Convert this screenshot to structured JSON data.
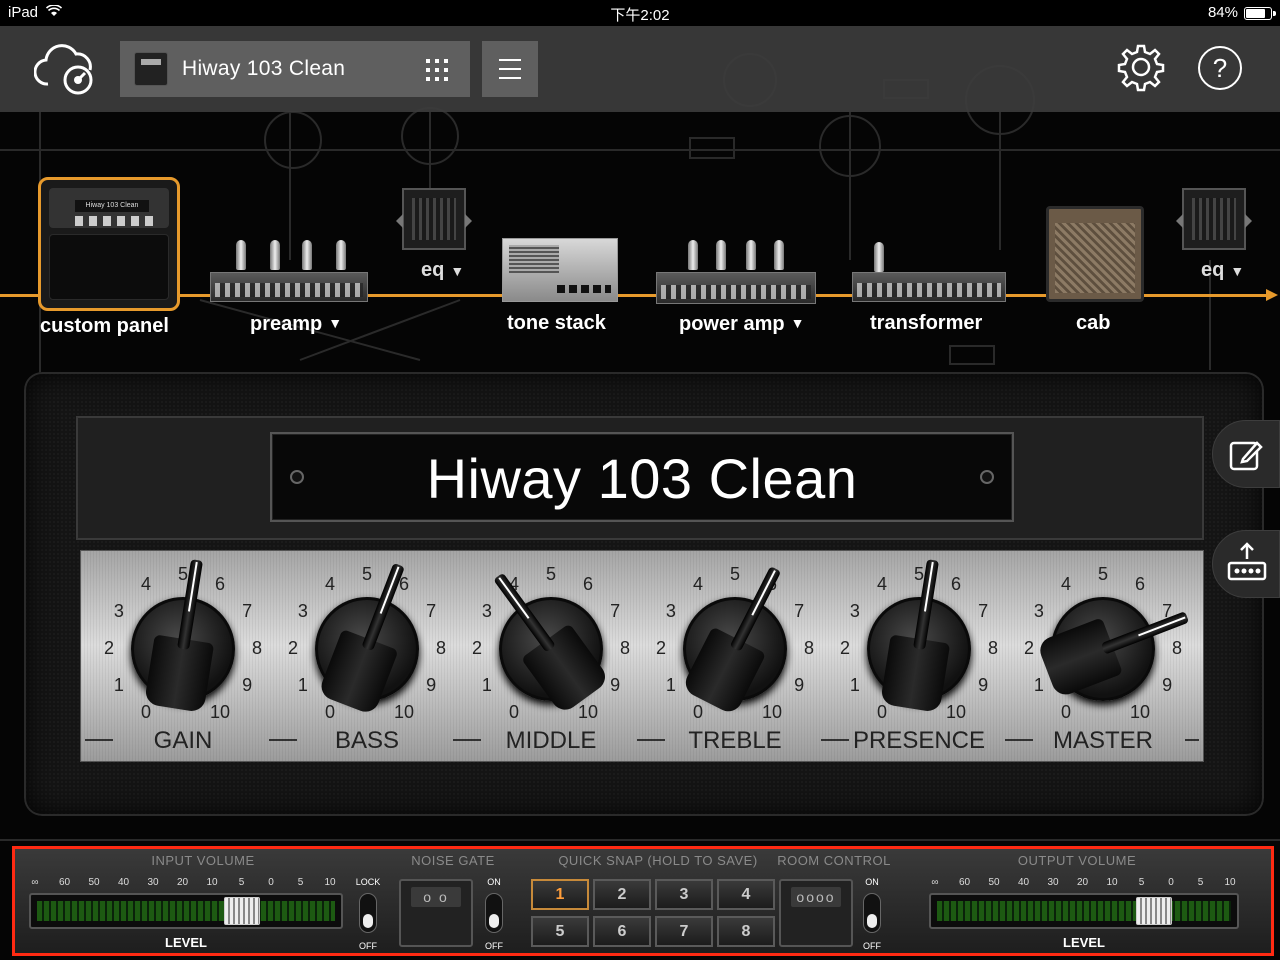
{
  "status_bar": {
    "device": "iPad",
    "time": "下午2:02",
    "battery_percent": "84%",
    "battery_level": 0.84
  },
  "toolbar": {
    "preset_name": "Hiway 103 Clean",
    "icons": [
      "cloud-icon",
      "preset-thumbnail-icon",
      "grid-icon",
      "menu-icon",
      "gear-icon",
      "help-icon"
    ],
    "help_label": "?"
  },
  "signal_chain": {
    "accent_color": "#e79a2c",
    "custom_panel_label": "custom panel",
    "custom_panel_preset": "Hiway 103 Clean",
    "preamp_label": "preamp",
    "tone_stack_label": "tone stack",
    "power_amp_label": "power amp",
    "transformer_label": "transformer",
    "cab_label": "cab",
    "eq_label": "eq",
    "dropdown_caret": "▼"
  },
  "amp": {
    "title": "Hiway 103 Clean",
    "knobs": [
      {
        "label": "GAIN",
        "value": 5.3
      },
      {
        "label": "BASS",
        "value": 5.7
      },
      {
        "label": "MIDDLE",
        "value": 3.8
      },
      {
        "label": "TREBLE",
        "value": 5.9
      },
      {
        "label": "PRESENCE",
        "value": 5.3
      },
      {
        "label": "MASTER",
        "value": 7.3
      }
    ],
    "scale_ticks": [
      "0",
      "1",
      "2",
      "3",
      "4",
      "5",
      "6",
      "7",
      "8",
      "9",
      "10"
    ]
  },
  "side_buttons": [
    "edit-icon",
    "export-icon"
  ],
  "bottom_rack": {
    "highlight_color": "#ff2a12",
    "input_volume": {
      "title": "INPUT VOLUME",
      "scale": [
        "∞",
        "60",
        "50",
        "40",
        "30",
        "20",
        "10",
        "5",
        "0",
        "5",
        "10"
      ],
      "level_label": "LEVEL",
      "level": 0.68
    },
    "lock_switch": {
      "on_label": "LOCK",
      "off_label": "OFF"
    },
    "noise_gate": {
      "title": "NOISE GATE",
      "on_label": "ON",
      "off_label": "OFF",
      "pedal_text": "o o"
    },
    "quick_snap": {
      "title": "QUICK SNAP (HOLD TO SAVE)",
      "buttons": [
        "1",
        "2",
        "3",
        "4",
        "5",
        "6",
        "7",
        "8"
      ],
      "active": "1"
    },
    "room_control": {
      "title": "ROOM CONTROL",
      "on_label": "ON",
      "off_label": "OFF",
      "pedal_text": "oooo"
    },
    "output_volume": {
      "title": "OUTPUT VOLUME",
      "scale": [
        "∞",
        "60",
        "50",
        "40",
        "30",
        "20",
        "10",
        "5",
        "0",
        "5",
        "10"
      ],
      "level_label": "LEVEL",
      "level": 0.73
    }
  }
}
